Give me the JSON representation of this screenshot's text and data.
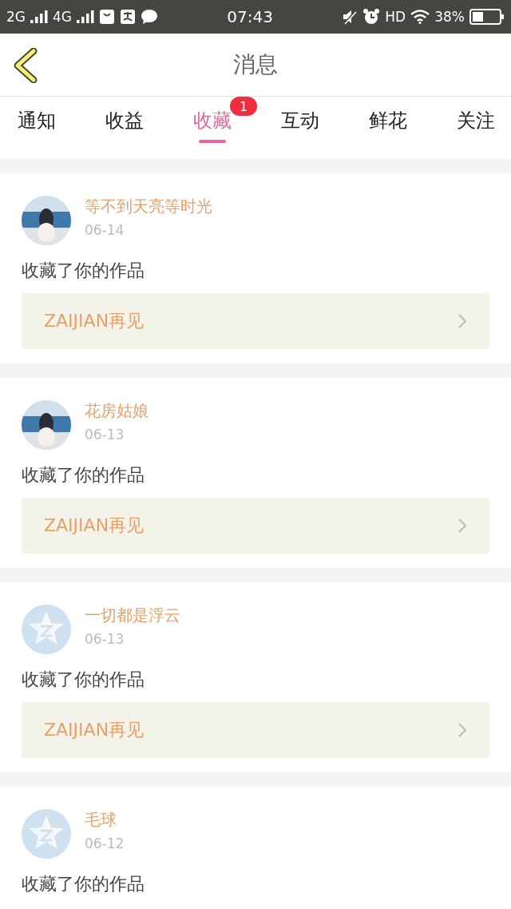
{
  "status_bar": {
    "network_1": "2G",
    "network_2": "4G",
    "time": "07:43",
    "hd": "HD",
    "battery": "38%"
  },
  "header": {
    "title": "消息"
  },
  "tabs": [
    {
      "label": "通知",
      "selected": false
    },
    {
      "label": "收益",
      "selected": false
    },
    {
      "label": "收藏",
      "selected": true,
      "badge": "1"
    },
    {
      "label": "互动",
      "selected": false
    },
    {
      "label": "鲜花",
      "selected": false
    },
    {
      "label": "关注",
      "selected": false
    }
  ],
  "messages": [
    {
      "user": "等不到天亮等时光",
      "date": "06-14",
      "text": "收藏了你的作品",
      "work": "ZAIJIAN再见"
    },
    {
      "user": "花房姑娘",
      "date": "06-13",
      "text": "收藏了你的作品",
      "work": "ZAIJIAN再见"
    },
    {
      "user": "一切都是浮云",
      "date": "06-13",
      "avatar": {
        "kind": "default"
      },
      "text": "收藏了你的作品",
      "work": "ZAIJIAN再见"
    },
    {
      "user": "毛球",
      "date": "06-12",
      "avatar": {
        "kind": "default"
      },
      "text": "收藏了你的作品"
    }
  ]
}
